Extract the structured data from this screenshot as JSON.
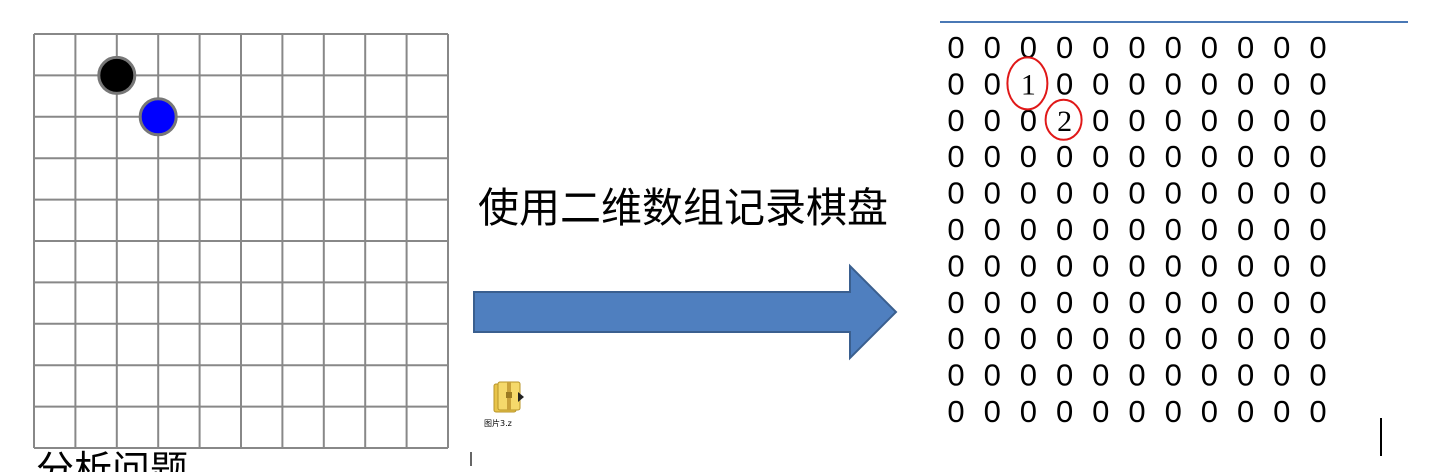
{
  "board": {
    "size": 10,
    "stones": [
      {
        "player": 1,
        "col": 2,
        "row": 1,
        "color": "#000000",
        "name": "black-stone"
      },
      {
        "player": 2,
        "col": 3,
        "row": 2,
        "color": "#0000ff",
        "name": "blue-stone"
      }
    ],
    "line_color": "#888888"
  },
  "caption_partial": "分析问题",
  "description": "使用二维数组记录棋盘",
  "arrow": {
    "fill": "#4f7fbf",
    "stroke": "#3a5f8f"
  },
  "file": {
    "name": "图片3.z",
    "icon": "zip-folder-icon"
  },
  "array": {
    "rows": [
      [
        "0",
        "0",
        "0",
        "0",
        "0",
        "0",
        "0",
        "0",
        "0",
        "0",
        "0"
      ],
      [
        "0",
        "0",
        "1",
        "0",
        "0",
        "0",
        "0",
        "0",
        "0",
        "0",
        "0"
      ],
      [
        "0",
        "0",
        "0",
        "2",
        "0",
        "0",
        "0",
        "0",
        "0",
        "0",
        "0"
      ],
      [
        "0",
        "0",
        "0",
        "0",
        "0",
        "0",
        "0",
        "0",
        "0",
        "0",
        "0"
      ],
      [
        "0",
        "0",
        "0",
        "0",
        "0",
        "0",
        "0",
        "0",
        "0",
        "0",
        "0"
      ],
      [
        "0",
        "0",
        "0",
        "0",
        "0",
        "0",
        "0",
        "0",
        "0",
        "0",
        "0"
      ],
      [
        "0",
        "0",
        "0",
        "0",
        "0",
        "0",
        "0",
        "0",
        "0",
        "0",
        "0"
      ],
      [
        "0",
        "0",
        "0",
        "0",
        "0",
        "0",
        "0",
        "0",
        "0",
        "0",
        "0"
      ],
      [
        "0",
        "0",
        "0",
        "0",
        "0",
        "0",
        "0",
        "0",
        "0",
        "0",
        "0"
      ],
      [
        "0",
        "0",
        "0",
        "0",
        "0",
        "0",
        "0",
        "0",
        "0",
        "0",
        "0"
      ],
      [
        "0",
        "0",
        "0",
        "0",
        "0",
        "0",
        "0",
        "0",
        "0",
        "0",
        "0"
      ]
    ],
    "highlight_color": "#e01818",
    "rule_color": "#4a78b5"
  }
}
